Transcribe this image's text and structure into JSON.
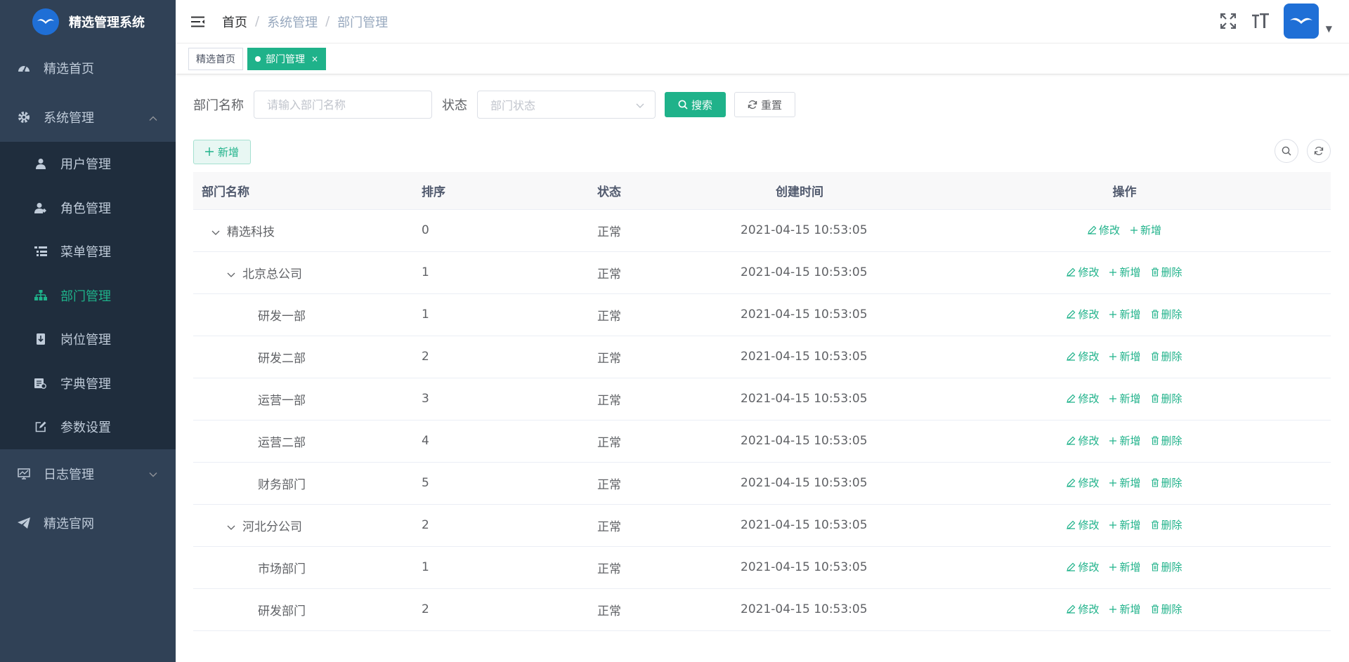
{
  "app": {
    "title": "精选管理系统"
  },
  "sidebar": {
    "items": [
      {
        "label": "精选首页"
      },
      {
        "label": "系统管理"
      },
      {
        "label": "日志管理"
      },
      {
        "label": "精选官网"
      }
    ],
    "submenu": [
      {
        "label": "用户管理"
      },
      {
        "label": "角色管理"
      },
      {
        "label": "菜单管理"
      },
      {
        "label": "部门管理"
      },
      {
        "label": "岗位管理"
      },
      {
        "label": "字典管理"
      },
      {
        "label": "参数设置"
      }
    ]
  },
  "breadcrumb": [
    "首页",
    "系统管理",
    "部门管理"
  ],
  "tags": [
    {
      "label": "精选首页"
    },
    {
      "label": "部门管理",
      "close": "×"
    }
  ],
  "search": {
    "name_label": "部门名称",
    "name_placeholder": "请输入部门名称",
    "status_label": "状态",
    "status_placeholder": "部门状态",
    "search_button": "搜索",
    "reset_button": "重置"
  },
  "toolbar": {
    "add_button": "新增"
  },
  "table": {
    "headers": [
      "部门名称",
      "排序",
      "状态",
      "创建时间",
      "操作"
    ],
    "actions": {
      "edit": "修改",
      "add": "新增",
      "delete": "删除"
    },
    "rows": [
      {
        "name": "精选科技",
        "sort": "0",
        "status": "正常",
        "created": "2021-04-15 10:53:05"
      },
      {
        "name": "北京总公司",
        "sort": "1",
        "status": "正常",
        "created": "2021-04-15 10:53:05"
      },
      {
        "name": "研发一部",
        "sort": "1",
        "status": "正常",
        "created": "2021-04-15 10:53:05"
      },
      {
        "name": "研发二部",
        "sort": "2",
        "status": "正常",
        "created": "2021-04-15 10:53:05"
      },
      {
        "name": "运营一部",
        "sort": "3",
        "status": "正常",
        "created": "2021-04-15 10:53:05"
      },
      {
        "name": "运营二部",
        "sort": "4",
        "status": "正常",
        "created": "2021-04-15 10:53:05"
      },
      {
        "name": "财务部门",
        "sort": "5",
        "status": "正常",
        "created": "2021-04-15 10:53:05"
      },
      {
        "name": "河北分公司",
        "sort": "2",
        "status": "正常",
        "created": "2021-04-15 10:53:05"
      },
      {
        "name": "市场部门",
        "sort": "1",
        "status": "正常",
        "created": "2021-04-15 10:53:05"
      },
      {
        "name": "研发部门",
        "sort": "2",
        "status": "正常",
        "created": "2021-04-15 10:53:05"
      }
    ]
  },
  "colors": {
    "sidebar_bg": "#304156",
    "submenu_bg": "#1f2d3d",
    "accent": "#1fb28a",
    "brand_blue": "#1f6fd6"
  }
}
